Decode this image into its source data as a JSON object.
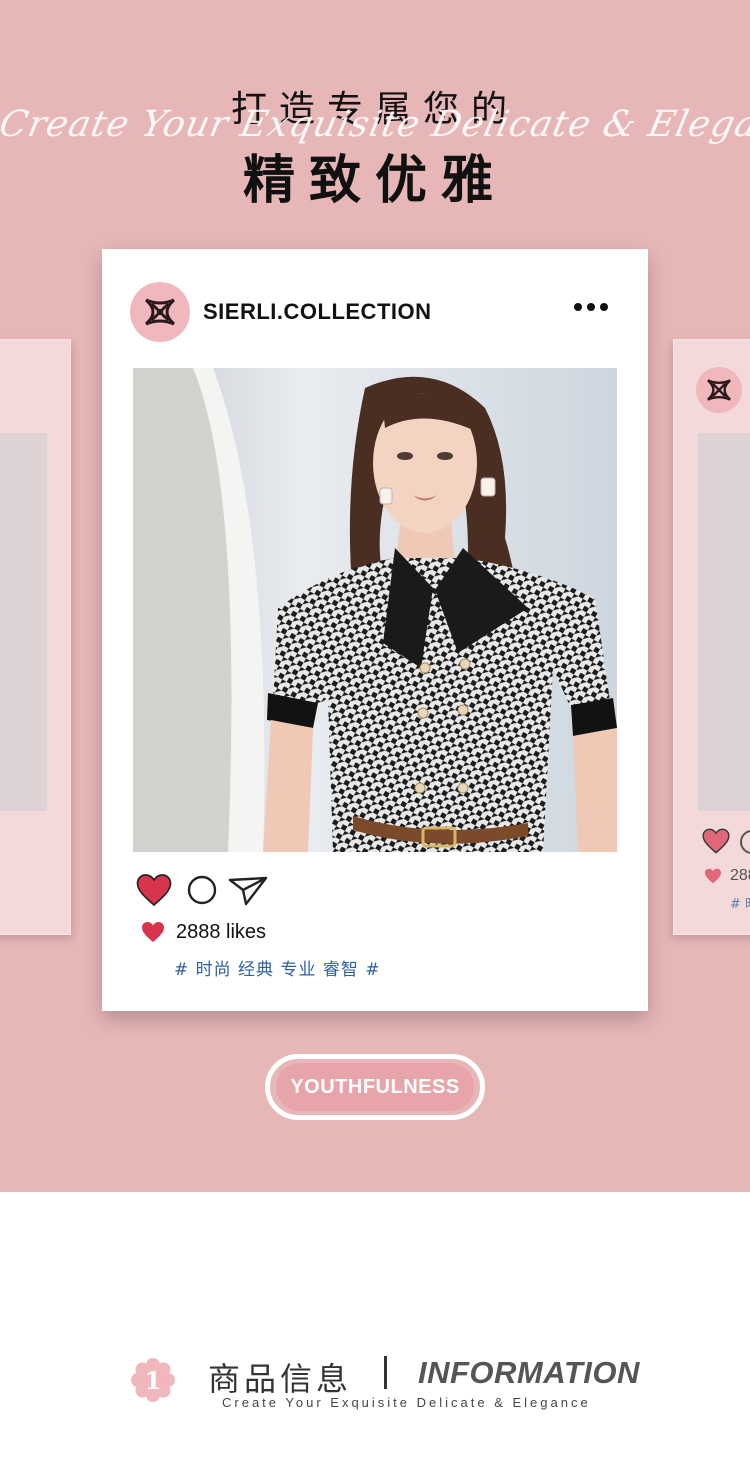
{
  "hero": {
    "title_line1": "打造专属您的",
    "script_line": "Create Your Exquisite Delicate & Elegance",
    "title_line2": "精致优雅"
  },
  "post": {
    "username": "SIERLI.COLLECTION",
    "more_icon": "more-dots-icon",
    "actions": [
      "heart-icon",
      "comment-icon",
      "share-icon"
    ],
    "likes": "2888 likes",
    "tags": "# 时尚 经典 专业 睿智 #"
  },
  "side_card_right": {
    "likes_partial": "288",
    "tag_partial": "# 时"
  },
  "pill": {
    "label": "YOUTHFULNESS"
  },
  "info": {
    "number": "1",
    "cn": "商品信息",
    "en": "INFORMATION",
    "subtitle": "Create Your Exquisite Delicate & Elegance"
  },
  "colors": {
    "background_pink": "#e7b6b7",
    "card_pink": "#f4d9da",
    "logo_pink": "#f0b7bc",
    "heart_red": "#d8344e",
    "tag_blue": "#2e5fa8"
  }
}
